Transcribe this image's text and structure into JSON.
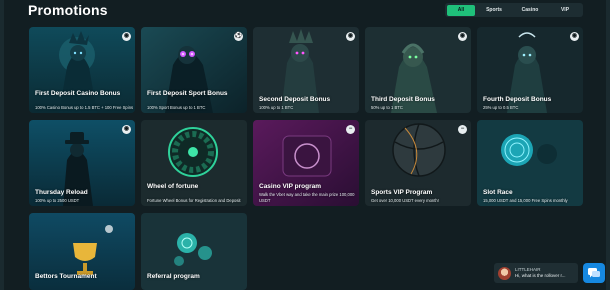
{
  "page": {
    "title": "Promotions"
  },
  "filters": [
    {
      "label": "All",
      "active": true
    },
    {
      "label": "Sports",
      "active": false
    },
    {
      "label": "Casino",
      "active": false
    },
    {
      "label": "VIP",
      "active": false
    }
  ],
  "cards": [
    {
      "title": "First Deposit Casino Bonus",
      "desc": "100% Casino Bonus up to 1.5 BTC + 100 Free Spins",
      "badge": "casino-chip-icon"
    },
    {
      "title": "First Deposit Sport Bonus",
      "desc": "100% Sport Bonus up to 1 BTC",
      "badge": "soccer-ball-icon"
    },
    {
      "title": "Second Deposit Bonus",
      "desc": "100% up to 1 BTC",
      "badge": "casino-chip-icon"
    },
    {
      "title": "Third Deposit Bonus",
      "desc": "50% up to 1 BTC",
      "badge": "casino-chip-icon"
    },
    {
      "title": "Fourth Deposit Bonus",
      "desc": "25% up to 0.5 BTC",
      "badge": "casino-chip-icon"
    },
    {
      "title": "Thursday Reload",
      "desc": "100% up to 2500 USDT",
      "badge": "casino-chip-icon"
    },
    {
      "title": "Wheel of fortune",
      "desc": "Fortune Wheel Bonus for Registration and Deposit",
      "badge": ""
    },
    {
      "title": "Casino VIP program",
      "desc": "Walk the Vbet way and take the main prize 100,000 USDT",
      "badge": "minus-icon"
    },
    {
      "title": "Sports VIP Program",
      "desc": "Get over 10,000 USDT every month!",
      "badge": "minus-icon"
    },
    {
      "title": "Slot Race",
      "desc": "15,000 USDT and 15,000 Free Spins monthly",
      "badge": ""
    },
    {
      "title": "Bettors Tournament",
      "desc": "",
      "badge": ""
    },
    {
      "title": "Referral program",
      "desc": "",
      "badge": ""
    }
  ],
  "chat": {
    "name": "LITTLEHAIR",
    "message": "Hi, what is the rollover r..."
  },
  "colors": {
    "accent": "#1fc07a",
    "background": "#121e22",
    "chat_button": "#1688e0"
  }
}
